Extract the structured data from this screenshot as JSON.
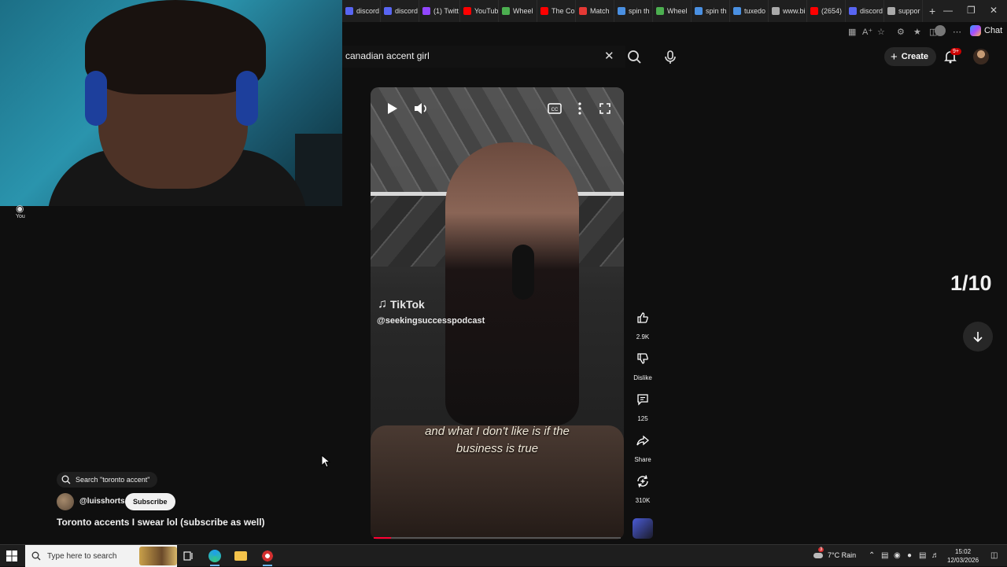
{
  "browser": {
    "tabs": [
      {
        "label": "discord",
        "color": "#5865f2"
      },
      {
        "label": "discord",
        "color": "#5865f2"
      },
      {
        "label": "(1) Twitt",
        "color": "#9146ff"
      },
      {
        "label": "YouTub",
        "color": "#ff0000"
      },
      {
        "label": "Wheel",
        "color": "#4caf50"
      },
      {
        "label": "The Co",
        "color": "#ff0000"
      },
      {
        "label": "Match",
        "color": "#e53935"
      },
      {
        "label": "spin th",
        "color": "#4a90e2"
      },
      {
        "label": "Wheel",
        "color": "#4caf50"
      },
      {
        "label": "spin th",
        "color": "#4a90e2"
      },
      {
        "label": "tuxedo",
        "color": "#4a90e2"
      },
      {
        "label": "www.bi",
        "color": "#aaaaaa"
      },
      {
        "label": "(2654)",
        "color": "#ff0000"
      },
      {
        "label": "discord",
        "color": "#5865f2"
      },
      {
        "label": "suppor",
        "color": "#aaaaaa"
      }
    ],
    "new_tab": "+",
    "chat_label": "Chat"
  },
  "youtube": {
    "search_value": "canadian accent girl",
    "create_label": "Create",
    "notification_badge": "9+",
    "sidebar_you_label": "You"
  },
  "short": {
    "search_chip": "Search \"toronto accent\"",
    "channel": "@luisshorts.",
    "subscribe_label": "Subscribe",
    "title": "Toronto accents I swear lol (subscribe as well)",
    "watermark_logo": "TikTok",
    "watermark_handle": "@seekingsuccesspodcast",
    "caption_line1": "and what I don't like is if the",
    "caption_line2": "business is true",
    "progress_fraction": 0.07,
    "actions": {
      "like_count": "2.9K",
      "dislike_label": "Dislike",
      "comment_count": "125",
      "share_label": "Share",
      "remix_count": "310K"
    },
    "counter": "1/10"
  },
  "taskbar": {
    "search_placeholder": "Type here to search",
    "weather_badge": "3",
    "weather": "7°C  Rain",
    "time": "15:02",
    "date": "12/03/2026"
  },
  "colors": {
    "accent_red": "#ff0033",
    "background": "#0f0f0f",
    "chip_bg": "#272727"
  }
}
